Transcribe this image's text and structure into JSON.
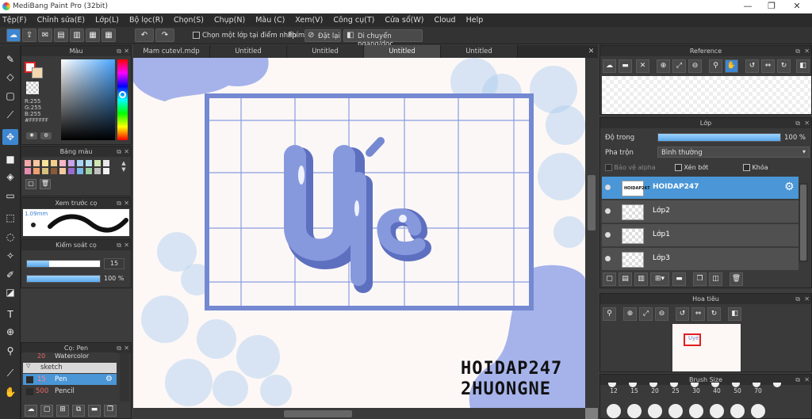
{
  "app": {
    "title": "MediBang Paint Pro (32bit)",
    "window_controls": [
      "—",
      "❐",
      "✕"
    ]
  },
  "menu": [
    "Tệp(F)",
    "Chỉnh sửa(E)",
    "Lớp(L)",
    "Bộ lọc(R)",
    "Chọn(S)",
    "Chụp(N)",
    "Màu (C)",
    "Xem(V)",
    "Công cụ(T)",
    "Cửa sổ(W)",
    "Cloud",
    "Help"
  ],
  "toolbar": {
    "select_one_layer": "Chọn một lớp tại điểm nhấp",
    "phim_label": "Phím",
    "reset_label": "Đặt lại",
    "flip_label": "Di chuyển ngang/dọc"
  },
  "color_panel": {
    "title": "Màu",
    "r": "R:255",
    "g": "G:255",
    "b": "B:255",
    "hex": "#FFFFFF"
  },
  "palette_panel": {
    "title": "Bảng màu"
  },
  "brush_preview_panel": {
    "title": "Xem trước cọ",
    "size": "1.09mm"
  },
  "brush_control_panel": {
    "title": "Kiểm soát cọ",
    "size_value": "15",
    "opacity_value": "100 %"
  },
  "brush_panel": {
    "title": "Cọ: Pen",
    "items": [
      {
        "size": "20",
        "name": "Watercolor"
      },
      {
        "size": "",
        "name": "sketch"
      },
      {
        "size": "15",
        "name": "Pen"
      },
      {
        "size": "500",
        "name": "Pencil"
      }
    ]
  },
  "tabs": [
    "Mam cutevl.mdp",
    "Untitled",
    "Untitled",
    "Untitled",
    "Untitled"
  ],
  "canvas": {
    "watermark_line1": "HOIDAP247",
    "watermark_line2": "2HUONGNE",
    "art_text": "Uyé"
  },
  "reference_panel": {
    "title": "Reference"
  },
  "layer_panel": {
    "title": "Lớp",
    "opacity_label": "Độ trong",
    "opacity_value": "100 %",
    "blend_label": "Pha trộn",
    "blend_value": "Bình thường",
    "protect_alpha": "Bảo vệ alpha",
    "clipping": "Xén bớt",
    "lock": "Khóa",
    "layers": [
      "HOIDAP247",
      "Lớp2",
      "Lớp1",
      "Lớp3"
    ]
  },
  "navigator_panel": {
    "title": "Hoa tiêu"
  },
  "brush_size_panel": {
    "title": "Brush Size",
    "sizes": [
      "12",
      "15",
      "20",
      "25",
      "30",
      "40",
      "50",
      "70"
    ]
  },
  "colors": {
    "accent": "#4a96d6",
    "artwork_blue": "#7b8fd6",
    "grid": "#7f93d8"
  }
}
